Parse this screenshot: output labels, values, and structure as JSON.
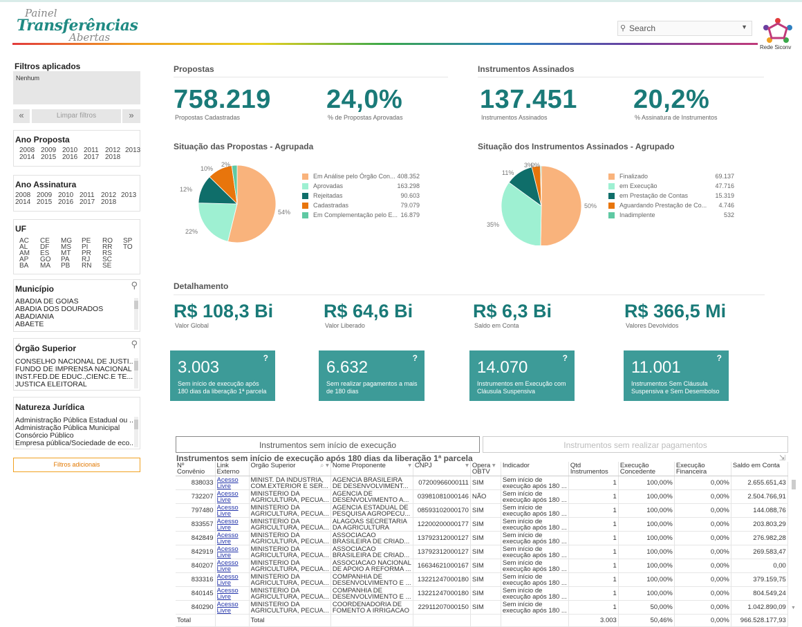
{
  "header": {
    "logo_line1": "Painel",
    "logo_line2": "Transferências",
    "logo_line3": "Abertas",
    "search_placeholder": "Search",
    "brand_right": "Rede Siconv"
  },
  "sidebar": {
    "filters_title": "Filtros aplicados",
    "filters_value": "Nenhum",
    "prev_label": "«",
    "clear_label": "Limpar filtros",
    "next_label": "»",
    "ano_proposta": {
      "title": "Ano Proposta",
      "years": [
        "2008",
        "2009",
        "2010",
        "2011",
        "2012",
        "2013",
        "2014",
        "2015",
        "2016",
        "2017",
        "2018"
      ]
    },
    "ano_assinatura": {
      "title": "Ano Assinatura",
      "years": [
        "2008",
        "2009",
        "2010",
        "2011",
        "2012",
        "2013",
        "2014",
        "2015",
        "2016",
        "2017",
        "2018"
      ]
    },
    "uf": {
      "title": "UF",
      "cols": [
        [
          "AC",
          "AL",
          "AM",
          "AP",
          "BA"
        ],
        [
          "CE",
          "DF",
          "ES",
          "GO",
          "MA"
        ],
        [
          "MG",
          "MS",
          "MT",
          "PA",
          "PB"
        ],
        [
          "PE",
          "PI",
          "PR",
          "RJ",
          "RN"
        ],
        [
          "RO",
          "RR",
          "RS",
          "SC",
          "SE"
        ],
        [
          "SP",
          "TO"
        ]
      ]
    },
    "municipio": {
      "title": "Município",
      "items": [
        "ABADIA DE GOIAS",
        "ABADIA DOS DOURADOS",
        "ABADIANIA",
        "ABAETE"
      ]
    },
    "orgao": {
      "title": "Órgão Superior",
      "items": [
        "CONSELHO NACIONAL DE JUSTI...",
        "FUNDO DE IMPRENSA NACIONAL",
        "INST.FED.DE EDUC.,CIENC.E TE...",
        "JUSTICA ELEITORAL"
      ]
    },
    "natureza": {
      "title": "Natureza Jurídica",
      "items": [
        "Administração Pública Estadual ou ...",
        "Administração Pública Municipal",
        "Consórcio Público",
        "Empresa pública/Sociedade de eco..."
      ]
    },
    "extra_filters_label": "Filtros adicionais"
  },
  "propostas": {
    "title": "Propostas",
    "total": "758.219",
    "total_label": "Propostas Cadastradas",
    "pct": "24,0%",
    "pct_label": "% de Propostas Aprovadas"
  },
  "instrumentos": {
    "title": "Instrumentos Assinados",
    "total": "137.451",
    "total_label": "Instrumentos Assinados",
    "pct": "20,2%",
    "pct_label": "% Assinatura de Instrumentos"
  },
  "chart_data": [
    {
      "type": "pie",
      "title": "Situação das Propostas - Agrupada",
      "labels": [
        "Em Análise pelo Órgão Con...",
        "Aprovadas",
        "Rejeitadas",
        "Cadastradas",
        "Em Complementação pelo E..."
      ],
      "values": [
        408352,
        163298,
        90603,
        79079,
        16879
      ],
      "value_labels": [
        "408.352",
        "163.298",
        "90.603",
        "79.079",
        "16.879"
      ],
      "pct_labels": [
        "54%",
        "22%",
        "12%",
        "10%",
        "2%"
      ],
      "colors": [
        "#f9b37c",
        "#9ef0d2",
        "#0f6e6a",
        "#e8750c",
        "#5fc9a3"
      ],
      "legend": "right"
    },
    {
      "type": "pie",
      "title": "Situação dos Instrumentos Assinados - Agrupado",
      "labels": [
        "Finalizado",
        "em Execução",
        "em Prestação de Contas",
        "Aguardando Prestação de Co...",
        "Inadimplente"
      ],
      "values": [
        69137,
        47716,
        15319,
        4746,
        532
      ],
      "value_labels": [
        "69.137",
        "47.716",
        "15.319",
        "4.746",
        "532"
      ],
      "pct_labels": [
        "50%",
        "35%",
        "11%",
        "3%",
        "0%"
      ],
      "colors": [
        "#f9b37c",
        "#9ef0d2",
        "#0f6e6a",
        "#e8750c",
        "#5fc9a3"
      ],
      "legend": "right"
    }
  ],
  "detalhamento": {
    "title": "Detalhamento",
    "values": [
      {
        "value": "R$ 108,3 Bi",
        "label": "Valor Global"
      },
      {
        "value": "R$ 64,6 Bi",
        "label": "Valor Liberado"
      },
      {
        "value": "R$ 6,3 Bi",
        "label": "Saldo em Conta"
      },
      {
        "value": "R$ 366,5 Mi",
        "label": "Valores Devolvidos"
      }
    ]
  },
  "cards": [
    {
      "num": "3.003",
      "q": "?",
      "line1": "Sem início de execução após",
      "line2": "180 dias da liberação 1ª parcela"
    },
    {
      "num": "6.632",
      "q": "?",
      "line1": "Sem realizar pagamentos a mais",
      "line2": "de 180 dias"
    },
    {
      "num": "14.070",
      "q": "?",
      "line1": "Instrumentos em Execução com",
      "line2": "Cláusula Suspensiva"
    },
    {
      "num": "11.001",
      "q": "?",
      "line1": "Instrumentos Sem Cláusula",
      "line2": "Suspensiva e Sem Desembolso"
    }
  ],
  "tabs": {
    "tab1": "Instrumentos sem início de execução",
    "tab2": "Instrumentos sem realizar pagamentos"
  },
  "table": {
    "title": "Instrumentos sem início de execução após 180 dias da liberação 1ª parcela",
    "headers": {
      "convenio_1": "Nº",
      "convenio_2": "Convênio",
      "link_1": "Link",
      "link_2": "Externo",
      "orgao": "Orgão Superior",
      "nome": "Nome Proponente",
      "cnpj": "CNPJ",
      "obtv_1": "Opera",
      "obtv_2": "OBTV",
      "indicador": "Indicador",
      "qtd_1": "Qtd",
      "qtd_2": "Instrumentos",
      "exec_conc_1": "Execução",
      "exec_conc_2": "Concedente",
      "exec_fin_1": "Execução",
      "exec_fin_2": "Financeira",
      "saldo": "Saldo em Conta"
    },
    "rows": [
      {
        "conv": "838033",
        "link1": "Acesso",
        "link2": "Livre",
        "org1": "MINIST. DA INDUSTRIA,",
        "org2": "COM.EXTERIOR E SER...",
        "nome1": "AGENCIA BRASILEIRA",
        "nome2": "DE DESENVOLVIMENT...",
        "cnpj": "07200966000111",
        "obtv": "SIM",
        "ind1": "Sem início de",
        "ind2": "execução após 180 ...",
        "qtd": "1",
        "ec": "100,00%",
        "ef": "0,00%",
        "saldo": "2.655.651,43"
      },
      {
        "conv": "732207",
        "link1": "Acesso",
        "link2": "Livre",
        "org1": "MINISTERIO DA",
        "org2": "AGRICULTURA, PECUA...",
        "nome1": "AGENCIA DE",
        "nome2": "DESENVOLVIMENTO A...",
        "cnpj": "03981081000146",
        "obtv": "NÃO",
        "ind1": "Sem início de",
        "ind2": "execução após 180 ...",
        "qtd": "1",
        "ec": "100,00%",
        "ef": "0,00%",
        "saldo": "2.504.766,91"
      },
      {
        "conv": "797480",
        "link1": "Acesso",
        "link2": "Livre",
        "org1": "MINISTERIO DA",
        "org2": "AGRICULTURA, PECUA...",
        "nome1": "AGENCIA ESTADUAL DE",
        "nome2": "PESQUISA AGROPECU...",
        "cnpj": "08593102000170",
        "obtv": "SIM",
        "ind1": "Sem início de",
        "ind2": "execução após 180 ...",
        "qtd": "1",
        "ec": "100,00%",
        "ef": "0,00%",
        "saldo": "144.088,76"
      },
      {
        "conv": "833557",
        "link1": "Acesso",
        "link2": "Livre",
        "org1": "MINISTERIO DA",
        "org2": "AGRICULTURA, PECUA...",
        "nome1": "ALAGOAS SECRETARIA",
        "nome2": "DA AGRICULTURA",
        "cnpj": "12200200000177",
        "obtv": "SIM",
        "ind1": "Sem início de",
        "ind2": "execução após 180 ...",
        "qtd": "1",
        "ec": "100,00%",
        "ef": "0,00%",
        "saldo": "203.803,29"
      },
      {
        "conv": "842849",
        "link1": "Acesso",
        "link2": "Livre",
        "org1": "MINISTERIO DA",
        "org2": "AGRICULTURA, PECUA...",
        "nome1": "ASSOCIACAO",
        "nome2": "BRASILEIRA DE CRIAD...",
        "cnpj": "13792312000127",
        "obtv": "SIM",
        "ind1": "Sem início de",
        "ind2": "execução após 180 ...",
        "qtd": "1",
        "ec": "100,00%",
        "ef": "0,00%",
        "saldo": "276.982,28"
      },
      {
        "conv": "842919",
        "link1": "Acesso",
        "link2": "Livre",
        "org1": "MINISTERIO DA",
        "org2": "AGRICULTURA, PECUA...",
        "nome1": "ASSOCIACAO",
        "nome2": "BRASILEIRA DE CRIAD...",
        "cnpj": "13792312000127",
        "obtv": "SIM",
        "ind1": "Sem início de",
        "ind2": "execução após 180 ...",
        "qtd": "1",
        "ec": "100,00%",
        "ef": "0,00%",
        "saldo": "269.583,47"
      },
      {
        "conv": "840207",
        "link1": "Acesso",
        "link2": "Livre",
        "org1": "MINISTERIO DA",
        "org2": "AGRICULTURA, PECUA...",
        "nome1": "ASSOCIACAO NACIONAL",
        "nome2": "DE APOIO A REFORMA ...",
        "cnpj": "16634621000167",
        "obtv": "SIM",
        "ind1": "Sem início de",
        "ind2": "execução após 180 ...",
        "qtd": "1",
        "ec": "100,00%",
        "ef": "0,00%",
        "saldo": "0,00"
      },
      {
        "conv": "833316",
        "link1": "Acesso",
        "link2": "Livre",
        "org1": "MINISTERIO DA",
        "org2": "AGRICULTURA, PECUA...",
        "nome1": "COMPANHIA DE",
        "nome2": "DESENVOLVIMENTO E ...",
        "cnpj": "13221247000180",
        "obtv": "SIM",
        "ind1": "Sem início de",
        "ind2": "execução após 180 ...",
        "qtd": "1",
        "ec": "100,00%",
        "ef": "0,00%",
        "saldo": "379.159,75"
      },
      {
        "conv": "840145",
        "link1": "Acesso",
        "link2": "Livre",
        "org1": "MINISTERIO DA",
        "org2": "AGRICULTURA, PECUA...",
        "nome1": "COMPANHIA DE",
        "nome2": "DESENVOLVIMENTO E ...",
        "cnpj": "13221247000180",
        "obtv": "SIM",
        "ind1": "Sem início de",
        "ind2": "execução após 180 ...",
        "qtd": "1",
        "ec": "100,00%",
        "ef": "0,00%",
        "saldo": "804.549,24"
      },
      {
        "conv": "840290",
        "link1": "Acesso",
        "link2": "Livre",
        "org1": "MINISTERIO DA",
        "org2": "AGRICULTURA, PECUA...",
        "nome1": "COORDENADORIA DE",
        "nome2": "FOMENTO A IRRIGACAO",
        "cnpj": "22911207000150",
        "obtv": "SIM",
        "ind1": "Sem início de",
        "ind2": "execução após 180 ...",
        "qtd": "1",
        "ec": "50,00%",
        "ef": "0,00%",
        "saldo": "1.042.890,09"
      }
    ],
    "total": {
      "label": "Total",
      "label2": "Total",
      "qtd": "3.003",
      "ec": "50,46%",
      "ef": "0,00%",
      "saldo": "966.528.177,93"
    }
  }
}
